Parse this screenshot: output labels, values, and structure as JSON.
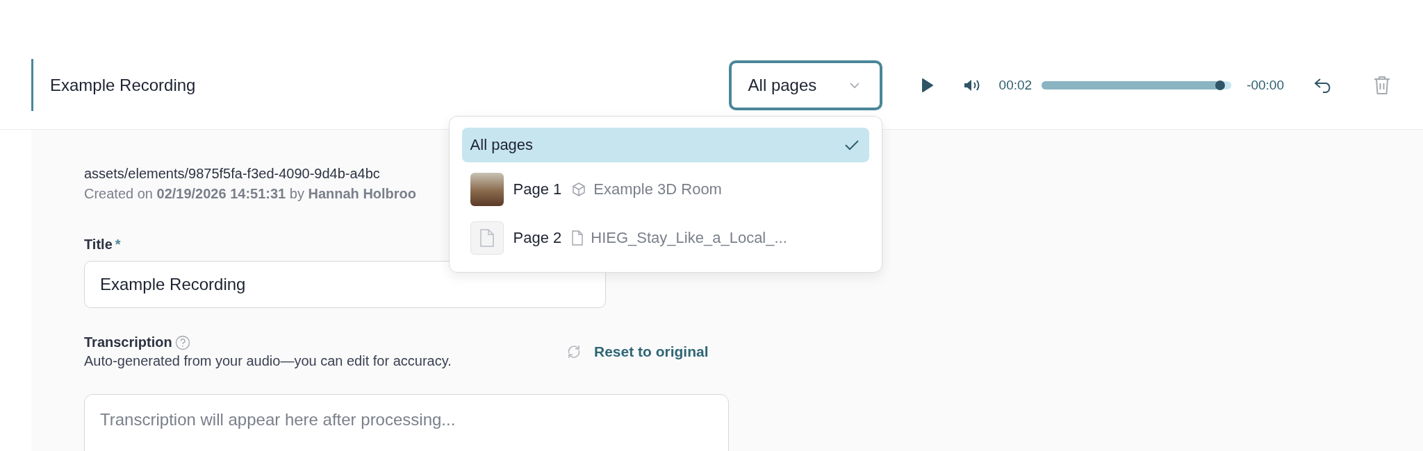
{
  "header": {
    "title": "Example Recording"
  },
  "page_select": {
    "value": "All pages",
    "expanded": true
  },
  "dropdown": {
    "options": [
      {
        "kind": "all",
        "label": "All pages",
        "selected": true
      },
      {
        "kind": "room3d",
        "label": "Page 1",
        "detail": "Example 3D Room",
        "selected": false
      },
      {
        "kind": "pdf",
        "label": "Page 2",
        "detail": "HIEG_Stay_Like_a_Local_...",
        "selected": false
      }
    ]
  },
  "player": {
    "playing": false,
    "elapsed": "00:02",
    "remaining": "-00:00",
    "level": 0.94
  },
  "asset": {
    "path": "assets/elements/9875f5fa-f3ed-4090-9d4b-a4bc",
    "created": "Created on **02/19/2026 14:51:31** by **Hannah Holbroo**"
  },
  "title_field": {
    "label": "Title",
    "required_mark": "*",
    "value": "Example Recording"
  },
  "transcription": {
    "label": "Transcription",
    "hint": "Auto-generated from your audio—you can edit for accuracy.",
    "reset_label": "Reset to original",
    "placeholder": "Transcription will appear here after processing..."
  }
}
